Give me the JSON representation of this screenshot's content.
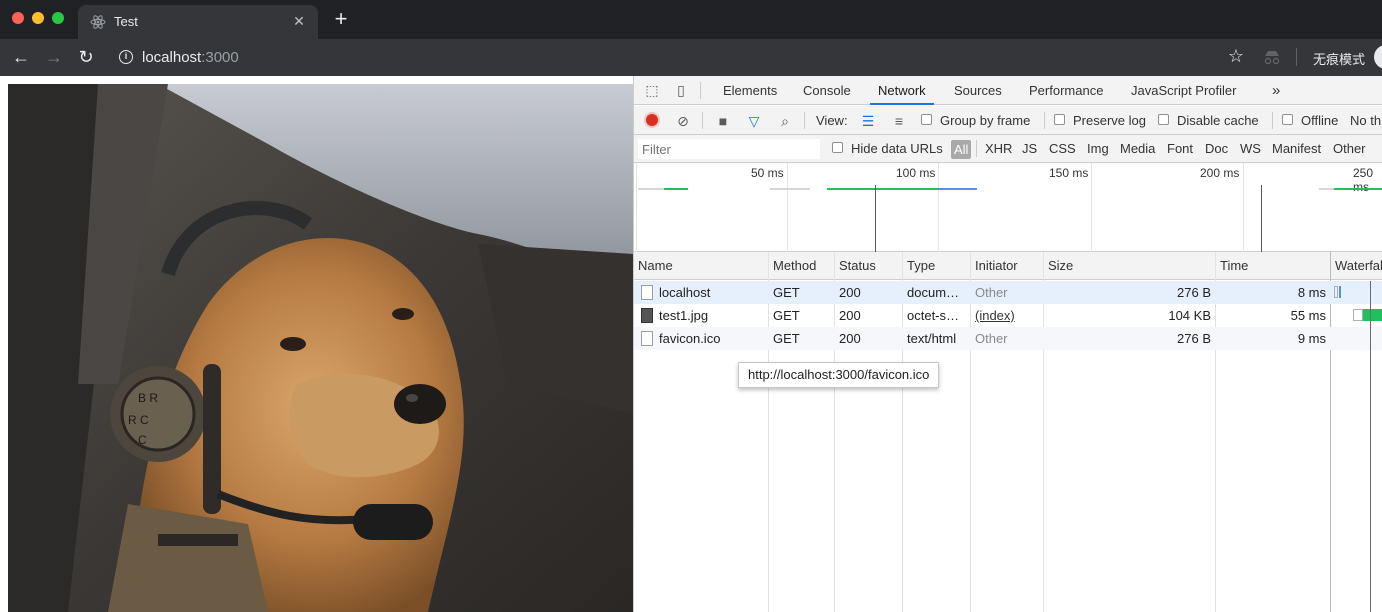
{
  "browser": {
    "tab_title": "Test",
    "tab_icon": "react-icon",
    "address": {
      "host": "localhost",
      "port": ":3000"
    },
    "incognito_label": "无痕模式"
  },
  "page": {
    "image": "golden-retriever-dog-wearing-headset-photo"
  },
  "devtools": {
    "tabs": [
      {
        "label": "Elements",
        "active": false
      },
      {
        "label": "Console",
        "active": false
      },
      {
        "label": "Network",
        "active": true
      },
      {
        "label": "Sources",
        "active": false
      },
      {
        "label": "Performance",
        "active": false
      },
      {
        "label": "JavaScript Profiler",
        "active": false
      }
    ],
    "more_tabs": "»",
    "toolbar": {
      "view_label": "View:",
      "group_by_frame": "Group by frame",
      "preserve_log": "Preserve log",
      "disable_cache": "Disable cache",
      "offline": "Offline",
      "throttle": "No th"
    },
    "filter": {
      "placeholder": "Filter",
      "hide_data_urls": "Hide data URLs",
      "types": [
        "All",
        "XHR",
        "JS",
        "CSS",
        "Img",
        "Media",
        "Font",
        "Doc",
        "WS",
        "Manifest",
        "Other"
      ],
      "active_type": "All"
    },
    "overview": {
      "ticks": [
        "50 ms",
        "100 ms",
        "150 ms",
        "200 ms",
        "250 ms"
      ]
    },
    "columns": [
      "Name",
      "Method",
      "Status",
      "Type",
      "Initiator",
      "Size",
      "Time",
      "Waterfall"
    ],
    "requests": [
      {
        "name": "localhost",
        "method": "GET",
        "status": "200",
        "type": "docum…",
        "initiator": "Other",
        "size": "276 B",
        "time": "8 ms",
        "icon": "document-icon"
      },
      {
        "name": "test1.jpg",
        "method": "GET",
        "status": "200",
        "type": "octet-s…",
        "initiator": "(index)",
        "size": "104 KB",
        "time": "55 ms",
        "icon": "image-icon"
      },
      {
        "name": "favicon.ico",
        "method": "GET",
        "status": "200",
        "type": "text/html",
        "initiator": "Other",
        "size": "276 B",
        "time": "9 ms",
        "icon": "document-icon"
      }
    ],
    "tooltip": "http://localhost:3000/favicon.ico"
  },
  "colors": {
    "accent": "#1a73e8",
    "record": "#d93025",
    "waterfall_green": "#20c05c",
    "waterfall_blue": "#5b8def"
  }
}
